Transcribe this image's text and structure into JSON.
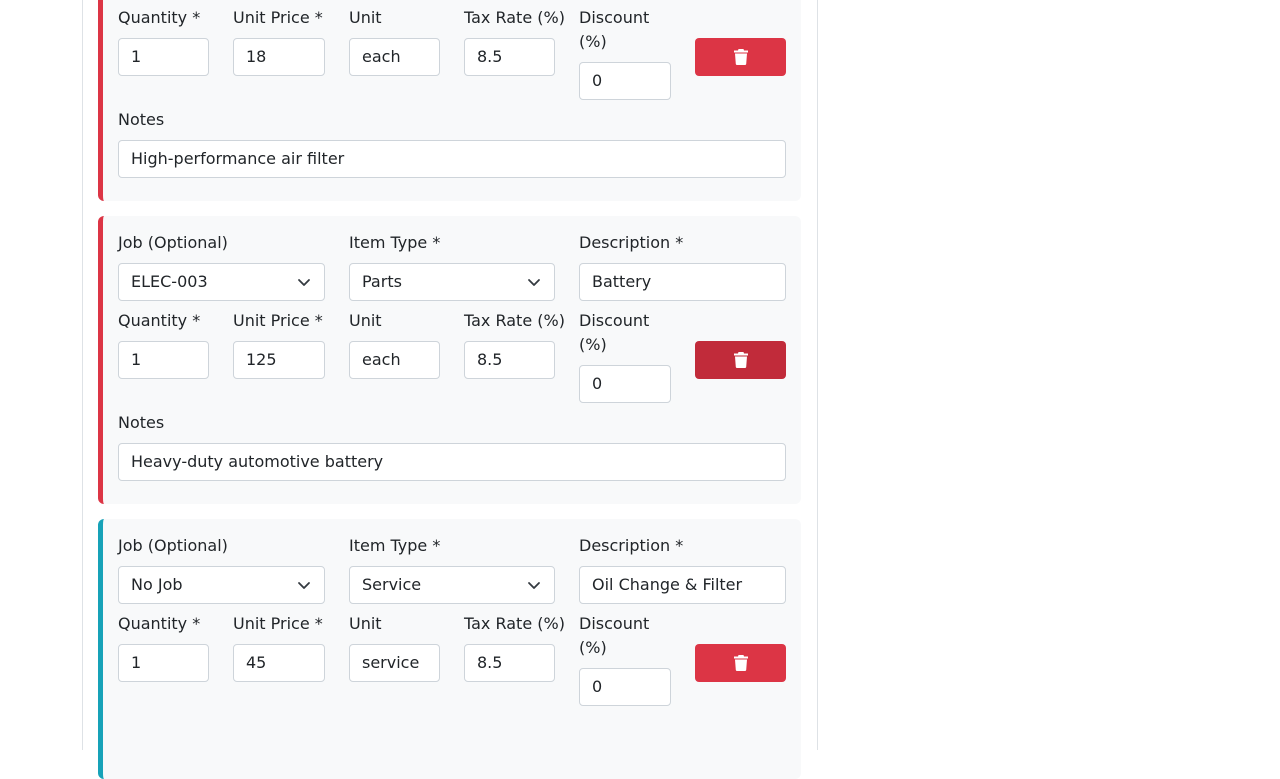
{
  "labels": {
    "quantity": "Quantity *",
    "unit_price": "Unit Price *",
    "unit": "Unit",
    "tax_rate": "Tax Rate (%)",
    "discount_line1": "Discount",
    "discount_line2": "(%)",
    "notes": "Notes",
    "job": "Job (Optional)",
    "item_type": "Item Type *",
    "description": "Description *"
  },
  "items": [
    {
      "quantity": "1",
      "unit_price": "18",
      "unit": "each",
      "tax_rate": "8.5",
      "discount": "0",
      "notes": "High-performance air filter"
    },
    {
      "job": "ELEC-003",
      "item_type": "Parts",
      "description": "Battery",
      "quantity": "1",
      "unit_price": "125",
      "unit": "each",
      "tax_rate": "8.5",
      "discount": "0",
      "notes": "Heavy-duty automotive battery"
    },
    {
      "job": "No Job",
      "item_type": "Service",
      "description": "Oil Change & Filter",
      "quantity": "1",
      "unit_price": "45",
      "unit": "service",
      "tax_rate": "8.5",
      "discount": "0"
    }
  ],
  "colors": {
    "parts_accent": "#dc3545",
    "service_accent": "#17a2b8",
    "delete_button": "#dc3545"
  },
  "icons": {
    "delete": "trash-icon",
    "select": "chevron-down-icon"
  }
}
